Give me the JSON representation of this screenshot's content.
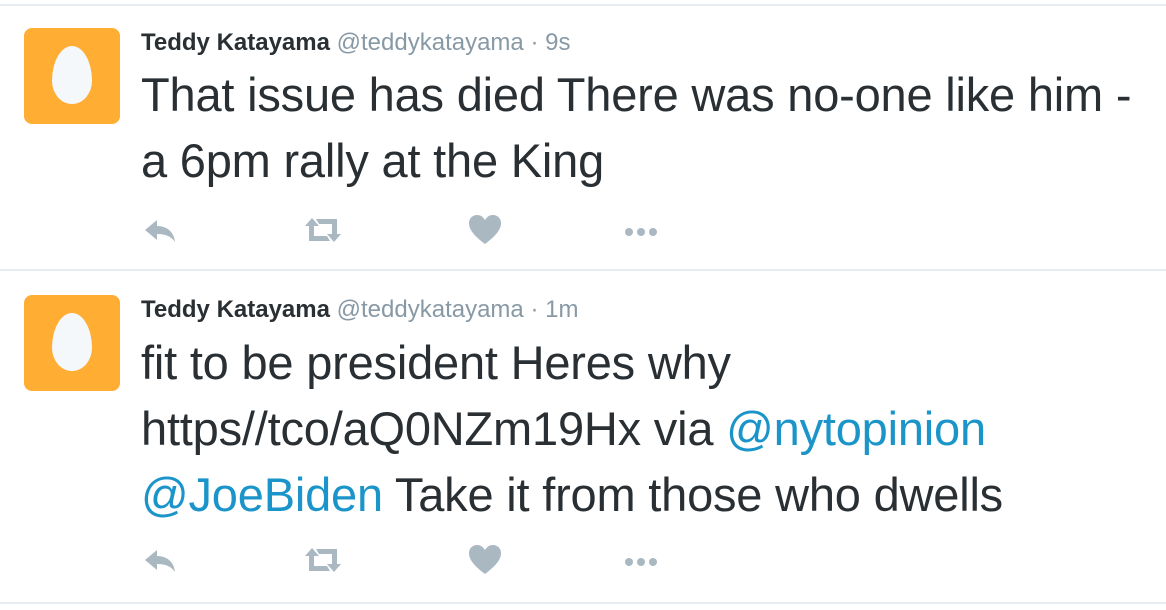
{
  "colors": {
    "name": "#292f33",
    "meta": "#8899a6",
    "mention": "#1b95c9",
    "icon": "#aab8c2",
    "avatar_bg": "#ffad33",
    "divider": "#e6ecf0"
  },
  "tweets": [
    {
      "name": "Teddy Katayama",
      "handle": "@teddykatayama",
      "separator": "·",
      "time": "9s",
      "text": "That issue has died There was no-one like him - a 6pm rally at the King",
      "avatar_icon": "egg-avatar-icon",
      "actions": [
        "reply-icon",
        "retweet-icon",
        "like-icon",
        "more-icon"
      ]
    },
    {
      "name": "Teddy Katayama",
      "handle": "@teddykatayama",
      "separator": "·",
      "time": "1m",
      "text_parts": {
        "line1": "fit to be president Heres why",
        "line2_text": "https//tco/aQ0NZm19Hx via ",
        "mention1": "@nytopinion",
        "mention2": "@JoeBiden",
        "line3_text": " Take it from those who dwells"
      },
      "avatar_icon": "egg-avatar-icon",
      "actions": [
        "reply-icon",
        "retweet-icon",
        "like-icon",
        "more-icon"
      ]
    }
  ]
}
